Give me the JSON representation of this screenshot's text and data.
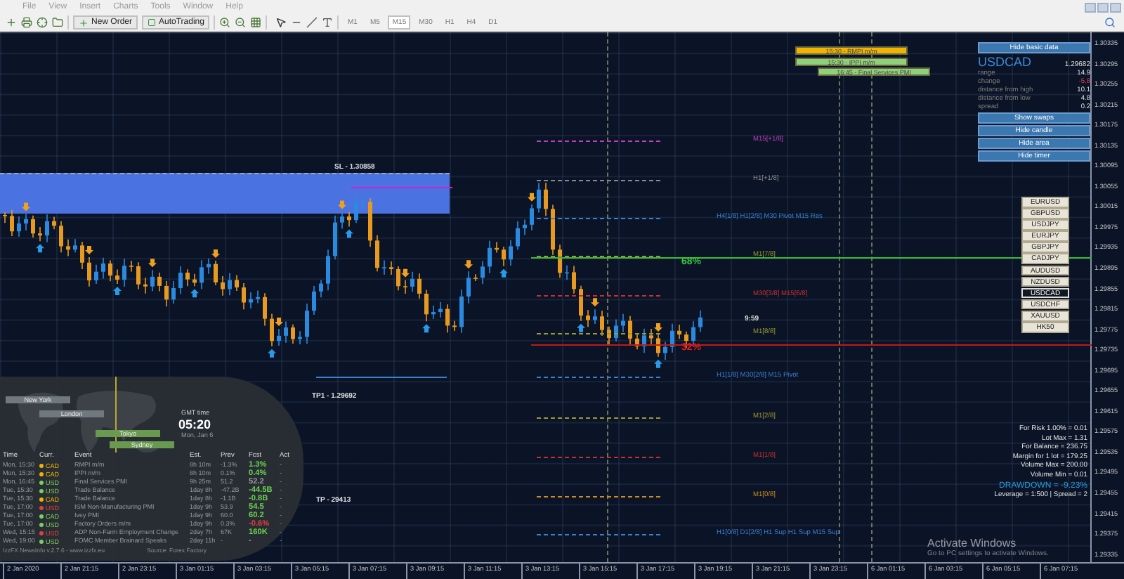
{
  "menu": [
    "File",
    "View",
    "Insert",
    "Charts",
    "Tools",
    "Window",
    "Help"
  ],
  "toolbar": {
    "new_order": "New Order",
    "autotrading": "AutoTrading",
    "timeframes": [
      {
        "label": "M1",
        "selected": false
      },
      {
        "label": "M5",
        "selected": false
      },
      {
        "label": "M15",
        "selected": true
      },
      {
        "label": "M30",
        "selected": false
      },
      {
        "label": "H1",
        "selected": false
      },
      {
        "label": "H4",
        "selected": false
      },
      {
        "label": "D1",
        "selected": false
      }
    ]
  },
  "chart": {
    "events": [
      {
        "label": "15:30 - RMPI m/m",
        "color": "#f0b400"
      },
      {
        "label": "15:30 - IPPI m/m",
        "color": "#8fd07a"
      },
      {
        "label": "16:45 - Final Services PMI",
        "color": "#8fd07a"
      }
    ],
    "levels": [
      {
        "label": "M15[+1/8]",
        "color": "#c040c0"
      },
      {
        "label": "H1[+1/8]",
        "color": "#8a8a8a"
      },
      {
        "label": "H4[1/8] H1[2/8] M30 Pivot M15 Res",
        "color": "#3a7fd0"
      },
      {
        "label": "M1[7/8]",
        "color": "#9a9a30"
      },
      {
        "label": "M30[3/8] M15[6/8]",
        "color": "#c83030"
      },
      {
        "label": "M1[8/8]",
        "color": "#9a9a30"
      },
      {
        "label": "H1[1/8] M30[2/8] M15 Pivot",
        "color": "#3a7fd0"
      },
      {
        "label": "M1[2/8]",
        "color": "#9a9a30"
      },
      {
        "label": "M1[1/8]",
        "color": "#c83030"
      },
      {
        "label": "M1[0/8]",
        "color": "#d08a20"
      },
      {
        "label": "H1[0/8] D1[2/8] H1 Sup H1 Sup M15 Sup",
        "color": "#3a7fd0"
      }
    ],
    "sl_label": "SL - 1.30858",
    "tp1_label": "TP1 - 1.29692",
    "tp_label": "TP - 29413",
    "upper_percent": "68%",
    "lower_percent": "32%",
    "timer": "9:59",
    "info_panel": {
      "toggle": "Hide basic data",
      "symbol": "USDCAD",
      "price": "1.29682",
      "stats": [
        {
          "label": "range",
          "value": "14.9",
          "kind": "plain"
        },
        {
          "label": "change",
          "value": "-5.8",
          "kind": "negative"
        },
        {
          "label": "distance from high",
          "value": "10.1",
          "kind": "plain"
        },
        {
          "label": "distance from low",
          "value": "4.8",
          "kind": "plain"
        },
        {
          "label": "spread",
          "value": "0.2",
          "kind": "plain"
        }
      ],
      "buttons": [
        "Show swaps",
        "Hide candle",
        "Hide area",
        "Hide timer"
      ]
    },
    "symbols": [
      {
        "label": "EURUSD",
        "selected": false
      },
      {
        "label": "GBPUSD",
        "selected": false
      },
      {
        "label": "USDJPY",
        "selected": false
      },
      {
        "label": "EURJPY",
        "selected": false
      },
      {
        "label": "GBPJPY",
        "selected": false
      },
      {
        "label": "CADJPY",
        "selected": false
      },
      {
        "label": "AUDUSD",
        "selected": false
      },
      {
        "label": "NZDUSD",
        "selected": false
      },
      {
        "label": "USDCAD",
        "selected": true
      },
      {
        "label": "USDCHF",
        "selected": false
      },
      {
        "label": "XAUUSD",
        "selected": false
      },
      {
        "label": "HK50",
        "selected": false
      }
    ],
    "risk": [
      {
        "text": "For Risk 1.00% = 0.01",
        "kind": "plain"
      },
      {
        "text": "Lot Max = 1.31",
        "kind": "plain"
      },
      {
        "text": "For Balance = 236.75",
        "kind": "plain"
      },
      {
        "text": "Margin for 1 lot = 179.25",
        "kind": "plain"
      },
      {
        "text": "Volume Max = 200.00",
        "kind": "plain"
      },
      {
        "text": "Volume Min = 0.01",
        "kind": "plain"
      },
      {
        "text": "DRAWDOWN = -9.23%",
        "kind": "alert"
      },
      {
        "text": "Leverage = 1:500 | Spread = 2",
        "kind": "plain"
      }
    ],
    "sessions_widget": {
      "sessions": [
        {
          "label": "New York",
          "open": false
        },
        {
          "label": "London",
          "open": false
        },
        {
          "label": "Tokyo",
          "open": true
        },
        {
          "label": "Sydney",
          "open": true
        }
      ],
      "clock_label": "GMT time",
      "clock": "05:20",
      "date": "Mon, Jan 6"
    },
    "news": {
      "columns": [
        "Time",
        "Curr.",
        "Event",
        "Est.",
        "Prev",
        "Fcst",
        "Act"
      ],
      "rows": [
        {
          "time": "Mon, 15:30",
          "currency": "CAD",
          "color": "#f0b400",
          "event": "RMPI m/m",
          "eta": "8h 10m",
          "previous": "-1.3%",
          "forecast": {
            "text": "1.3%",
            "color": "#6ad050"
          },
          "actual": "-"
        },
        {
          "time": "Mon, 15:30",
          "currency": "CAD",
          "color": "#f0b400",
          "event": "IPPI m/m",
          "eta": "8h 10m",
          "previous": "0.1%",
          "forecast": {
            "text": "0.4%",
            "color": "#6ad050"
          },
          "actual": "-"
        },
        {
          "time": "Mon, 16:45",
          "currency": "USD",
          "color": "#7cd060",
          "event": "Final Services PMI",
          "eta": "9h 25m",
          "previous": "51.2",
          "forecast": {
            "text": "52.2",
            "color": "#999999"
          },
          "actual": "-"
        },
        {
          "time": "Tue, 15:30",
          "currency": "USD",
          "color": "#7cd060",
          "event": "Trade Balance",
          "eta": "1day 8h",
          "previous": "-47.2B",
          "forecast": {
            "text": "-44.5B",
            "color": "#6ad050"
          },
          "actual": "-"
        },
        {
          "time": "Tue, 15:30",
          "currency": "CAD",
          "color": "#f0b400",
          "event": "Trade Balance",
          "eta": "1day 8h",
          "previous": "-1.1B",
          "forecast": {
            "text": "-0.8B",
            "color": "#6ad050"
          },
          "actual": "-"
        },
        {
          "time": "Tue, 17:00",
          "currency": "USD",
          "color": "#e04040",
          "event": "ISM Non-Manufacturing PMI",
          "eta": "1day 9h",
          "previous": "53.9",
          "forecast": {
            "text": "54.5",
            "color": "#6ad050"
          },
          "actual": "-"
        },
        {
          "time": "Tue, 17:00",
          "currency": "CAD",
          "color": "#7cd060",
          "event": "Ivey PMI",
          "eta": "1day 9h",
          "previous": "60.0",
          "forecast": {
            "text": "60.2",
            "color": "#6ad050"
          },
          "actual": "-"
        },
        {
          "time": "Tue, 17:00",
          "currency": "USD",
          "color": "#7cd060",
          "event": "Factory Orders m/m",
          "eta": "1day 9h",
          "previous": "0.3%",
          "forecast": {
            "text": "-0.6%",
            "color": "#e04040"
          },
          "actual": "-"
        },
        {
          "time": "Wed, 15:15",
          "currency": "USD",
          "color": "#e04040",
          "event": "ADP Non-Farm Employment Change",
          "eta": "2day 7h",
          "previous": "67K",
          "forecast": {
            "text": "160K",
            "color": "#6ad050"
          },
          "actual": "-"
        },
        {
          "time": "Wed, 19:00",
          "currency": "USD",
          "color": "#7cd060",
          "event": "FOMC Member Brainard Speaks",
          "eta": "2day 11h",
          "previous": "-",
          "forecast": {
            "text": "-"
          },
          "actual": "-"
        }
      ],
      "footer": "IzzFX NewsInfo v.2.7.6  -  www.izzfx.eu",
      "source": "Source: Forex Factory"
    }
  },
  "price_axis": [
    "1.30335",
    "1.30295",
    "1.30255",
    "1.30215",
    "1.30175",
    "1.30135",
    "1.30095",
    "1.30055",
    "1.30015",
    "1.29975",
    "1.29935",
    "1.29895",
    "1.29855",
    "1.29815",
    "1.29775",
    "1.29735",
    "1.29695",
    "1.29655",
    "1.29615",
    "1.29575",
    "1.29535",
    "1.29495",
    "1.29455",
    "1.29415",
    "1.29375",
    "1.29335"
  ],
  "time_axis": [
    "2 Jan 2020",
    "2 Jan 21:15",
    "2 Jan 23:15",
    "3 Jan 01:15",
    "3 Jan 03:15",
    "3 Jan 05:15",
    "3 Jan 07:15",
    "3 Jan 09:15",
    "3 Jan 11:15",
    "3 Jan 13:15",
    "3 Jan 15:15",
    "3 Jan 17:15",
    "3 Jan 19:15",
    "3 Jan 21:15",
    "3 Jan 23:15",
    "6 Jan 01:15",
    "6 Jan 03:15",
    "6 Jan 05:15",
    "6 Jan 07:15"
  ],
  "os_notice": {
    "title": "Activate Windows",
    "text": "Go to PC settings to activate Windows."
  }
}
